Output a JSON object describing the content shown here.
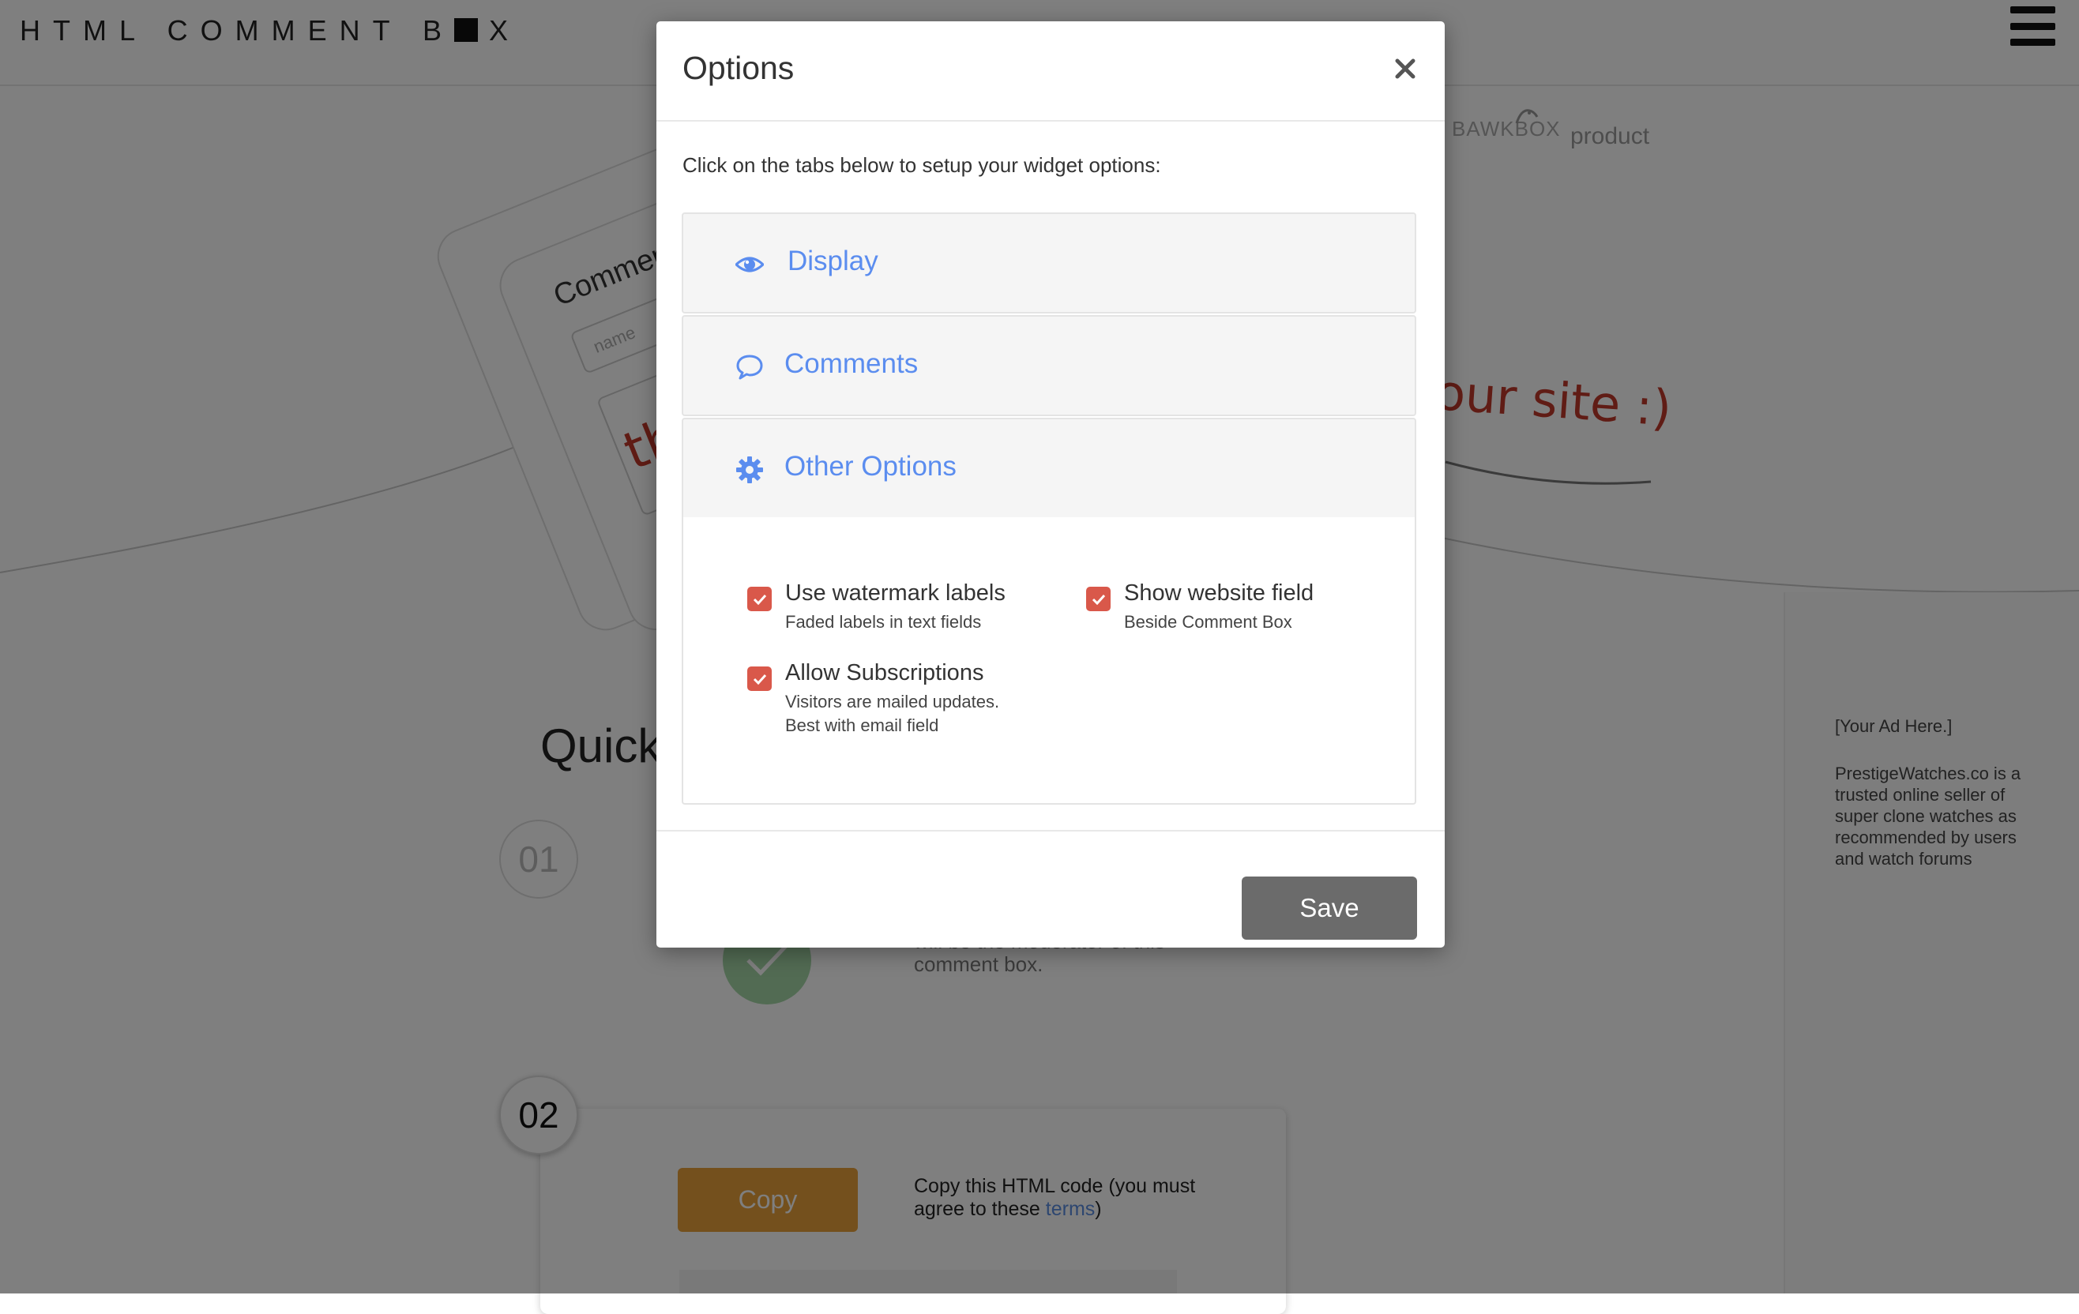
{
  "header": {
    "brand_before": "HTML COMMENT B",
    "brand_after": "X",
    "menu_icon": "hamburger-icon"
  },
  "hero": {
    "bawkbox_label": "BAWKBOX",
    "product_label": "product",
    "card_title": "Comment",
    "card_name_placeholder": "name",
    "card_handwriting": "th",
    "tagline_handwriting": "our site :)"
  },
  "quick": {
    "title": "Quick",
    "step1": "01",
    "step2": "02",
    "moderator_text": "will be the moderator of this comment box.",
    "copy_label": "Copy",
    "copy_text_prefix": "Copy this HTML code (you must agree to these ",
    "copy_link": "terms",
    "copy_text_suffix": ")"
  },
  "sidebar": {
    "ad_title": "[Your Ad Here.]",
    "ad_text": "PrestigeWatches.co is a trusted online seller of super clone watches as recommended by users and watch forums"
  },
  "modal": {
    "title": "Options",
    "close_icon": "close-icon",
    "intro": "Click on the tabs below to setup your widget options:",
    "tabs": [
      {
        "label": "Display",
        "icon": "eye-icon"
      },
      {
        "label": "Comments",
        "icon": "speech-bubble-icon"
      },
      {
        "label": "Other Options",
        "icon": "gear-icon",
        "expanded": true
      }
    ],
    "options": [
      {
        "title": "Use watermark labels",
        "desc": "Faded labels in text fields",
        "checked": true
      },
      {
        "title": "Show website field",
        "desc": "Beside Comment Box",
        "checked": true
      },
      {
        "title": "Allow Subscriptions",
        "desc": "Visitors are mailed updates.",
        "desc2": "Best with email field",
        "checked": true
      }
    ],
    "save_label": "Save"
  },
  "colors": {
    "accent_blue": "#5b8def",
    "checkbox_red": "#d9584a",
    "save_gray": "#6b6b6b",
    "copy_orange": "#e8a13a",
    "handwriting_red": "#c0392b"
  }
}
